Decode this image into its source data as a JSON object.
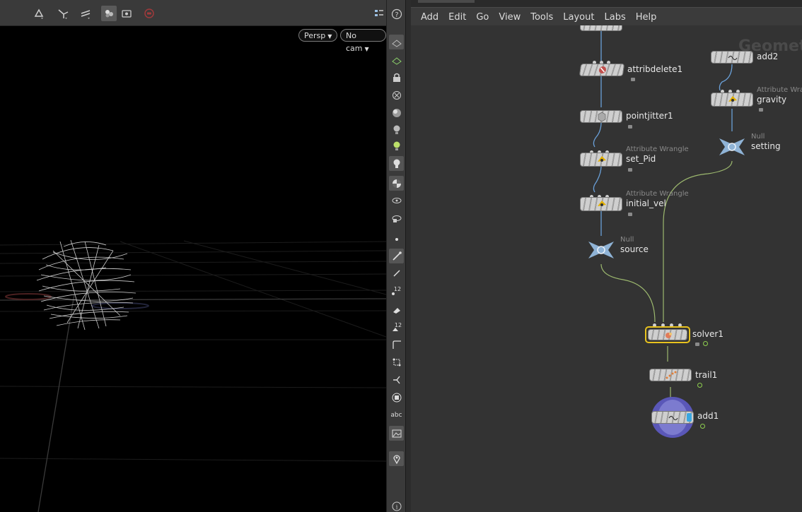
{
  "viewport": {
    "camera_menu": "Persp",
    "cam_menu": "No cam",
    "toolbar_icons": [
      "select-mode-icon",
      "move-tool-icon",
      "handle-tool-icon",
      "display-options-icon",
      "snapshot-icon",
      "record-icon",
      "help-icon"
    ]
  },
  "shelf": {
    "icons": [
      "wire-display-icon",
      "visibility-icon",
      "lock-icon",
      "ghost-icon",
      "shading-icon",
      "light-icon",
      "headlight-icon",
      "skeleton-icon",
      "texture-icon",
      "camera-icon",
      "render-icon",
      "point-icon",
      "brush-icon",
      "edge-icon",
      "number-points-icon",
      "paint-icon",
      "prim-numbers-icon",
      "normal-icon",
      "vertex-icon",
      "select-icon",
      "bounding-box-icon",
      "text-icon",
      "image-icon",
      "pin-icon",
      "info-icon"
    ],
    "labels": {
      "n12a": "12",
      "n12b": "12",
      "abc": "abc"
    }
  },
  "network": {
    "menu": [
      "Add",
      "Edit",
      "Go",
      "View",
      "Tools",
      "Layout",
      "Labs",
      "Help"
    ],
    "context_label": "Geomet",
    "nodes": {
      "attribdelete1": {
        "name": "attribdelete1",
        "type": ""
      },
      "pointjitter1": {
        "name": "pointjitter1",
        "type": ""
      },
      "set_pid": {
        "name": "set_Pid",
        "type": "Attribute Wrangle"
      },
      "initial_vel": {
        "name": "initial_vel",
        "type": "Attribute Wrangle"
      },
      "source": {
        "name": "source",
        "type": "Null"
      },
      "add2": {
        "name": "add2",
        "type": ""
      },
      "gravity": {
        "name": "gravity",
        "type": "Attribute Wra"
      },
      "setting": {
        "name": "setting",
        "type": "Null"
      },
      "solver1": {
        "name": "solver1",
        "type": ""
      },
      "trail1": {
        "name": "trail1",
        "type": ""
      },
      "add1": {
        "name": "add1",
        "type": ""
      }
    },
    "colors": {
      "selected_outline": "#e8c21e",
      "wire": "#9cb86e",
      "wire_blue": "#6aa0d8",
      "display_flag": "#3aa7e0",
      "render_flag": "#5a57b8"
    }
  }
}
